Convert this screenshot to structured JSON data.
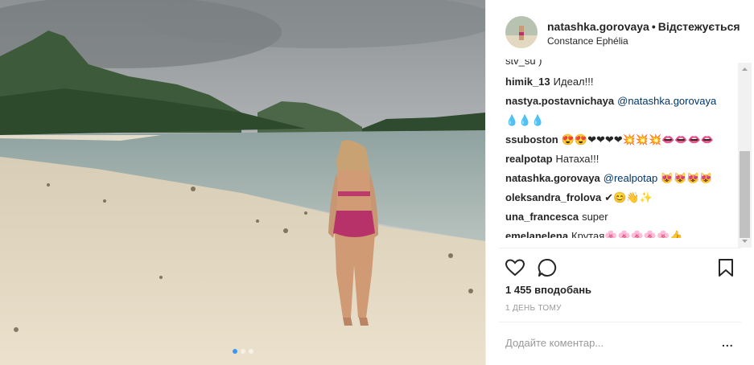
{
  "photo": {
    "dots_total": 3,
    "dot_active": 1
  },
  "header": {
    "username": "natashka.gorovaya",
    "separator": "•",
    "follow_status": "Відстежується",
    "location": "Constance Ephélia"
  },
  "comments": [
    {
      "user": "himik_13",
      "text": "Идеал!!!"
    },
    {
      "user": "nastya.postavnichaya",
      "text": "@natashka.gorovaya",
      "mention": true
    },
    {
      "user": "",
      "text": "💧💧💧",
      "continuation": true
    },
    {
      "user": "ssuboston",
      "text": "😍😍❤❤❤❤💥💥💥👄👄👄👄"
    },
    {
      "user": "realpotap",
      "text": "Натаха!!!"
    },
    {
      "user": "natashka.gorovaya",
      "text": "@realpotap 😻😻😻😻",
      "mention": true
    },
    {
      "user": "oleksandra_frolova",
      "text": "✔😊👋✨"
    },
    {
      "user": "una_francesca",
      "text": "super"
    },
    {
      "user": "emelanelena",
      "text": "Крутая🌸🌸🌸🌸🌸👍"
    }
  ],
  "partial_top_comment": "stv_su )",
  "actions": {
    "like_icon": "heart-icon",
    "comment_icon": "comment-icon",
    "save_icon": "bookmark-icon"
  },
  "likes": "1 455 вподобань",
  "time": "1 ДЕНЬ ТОМУ",
  "add_comment": {
    "placeholder": "Додайте коментар...",
    "value": ""
  },
  "more_label": "..."
}
